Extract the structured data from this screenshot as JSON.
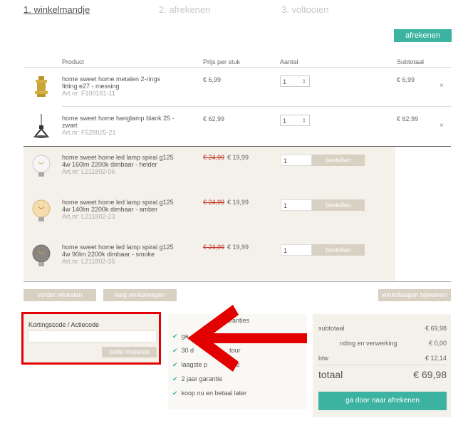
{
  "steps": [
    "1. winkelmandje",
    "2. afrekenen",
    "3. voltooien"
  ],
  "checkout_button": "afrekenen",
  "table_headers": {
    "product": "Product",
    "price": "Prijs per stuk",
    "qty": "Aantal",
    "subtotal": "Subtotaal"
  },
  "cart_items": [
    {
      "name": "home sweet home metalen 2-rings fitting e27 - messing",
      "art": "Art.nr: F100161-11",
      "price": "€ 6,99",
      "qty": "1",
      "subtotal": "€ 6,99",
      "remove": "×"
    },
    {
      "name": "home sweet home hanglamp blank 25 - zwart",
      "art": "Art.nr: F528025-21",
      "price": "€ 62,99",
      "qty": "1",
      "subtotal": "€ 62,99",
      "remove": "×"
    }
  ],
  "suggestions": [
    {
      "name": "home sweet home led lamp spiral g125 4w 160lm 2200k dimbaar - helder",
      "art": "Art.nr: L211802-06",
      "old_price": "€ 24,99",
      "price": "€ 19,99",
      "qty": "1",
      "button": "bestellen"
    },
    {
      "name": "home sweet home led lamp spiral g125 4w 140lm 2200k dimbaar - amber",
      "art": "Art.nr: L211802-23",
      "old_price": "€ 24,99",
      "price": "€ 19,99",
      "qty": "1",
      "button": "bestellen"
    },
    {
      "name": "home sweet home led lamp spiral g125 4w 90lm 2200k dimbaar - smoke",
      "art": "Art.nr: L211802-35",
      "old_price": "€ 24,99",
      "price": "€ 19,99",
      "qty": "1",
      "button": "bestellen"
    }
  ],
  "actions": {
    "continue": "verder winkelen",
    "empty": "leeg winkelwagen",
    "update": "winkelwagen bijwerken"
  },
  "coupon": {
    "label": "Kortingscode / Actiecode",
    "placeholder": "",
    "button": "code invoeren"
  },
  "guarantees": {
    "title": "garanties",
    "items": [
      "gratis verzending",
      "30 dagen retour",
      "laagste prijs garantie",
      "2 jaar garantie",
      "koop nu en betaal later"
    ],
    "visible_items": [
      "ga",
      "30 d",
      "laagste p",
      "2 jaar garantie",
      "koop nu en betaal later"
    ],
    "visible_tail": [
      "",
      "tour",
      "antie",
      "",
      ""
    ]
  },
  "totals": {
    "subtotal_label": "subtotaal",
    "subtotal": "€ 69,98",
    "shipping_label": "nding en verwerking",
    "shipping": "€ 0,00",
    "tax_label": "btw",
    "tax": "€ 12,14",
    "total_label": "totaal",
    "total": "€ 69,98",
    "proceed": "ga door naar afrekenen"
  },
  "colors": {
    "accent": "#3bb3a0",
    "highlight": "#e30000",
    "panel": "#f4f0ea",
    "muted_button": "#d8d0c2"
  }
}
